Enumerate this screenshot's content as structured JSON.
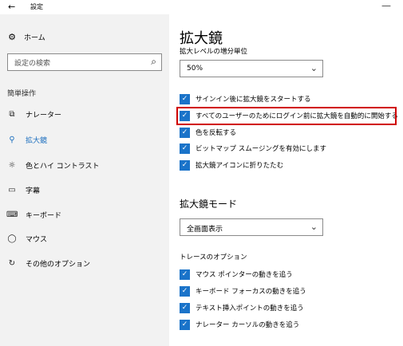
{
  "window": {
    "title": "設定",
    "back_glyph": "←",
    "minimize_glyph": "—"
  },
  "sidebar": {
    "home": {
      "label": "ホーム",
      "icon": "gear-icon",
      "glyph": "⚙"
    },
    "search": {
      "placeholder": "設定の検索",
      "icon": "search-icon",
      "glyph": "⌕"
    },
    "section_heading": "簡単操作",
    "items": [
      {
        "label": "ナレーター",
        "icon": "narrator-icon",
        "glyph": "⧉",
        "active": false
      },
      {
        "label": "拡大鏡",
        "icon": "magnifier-icon",
        "glyph": "⚲",
        "active": true
      },
      {
        "label": "色とハイ コントラスト",
        "icon": "sun-icon",
        "glyph": "☼",
        "active": false
      },
      {
        "label": "字幕",
        "icon": "captions-icon",
        "glyph": "▭",
        "active": false
      },
      {
        "label": "キーボード",
        "icon": "keyboard-icon",
        "glyph": "⌨",
        "active": false
      },
      {
        "label": "マウス",
        "icon": "mouse-icon",
        "glyph": "◯",
        "active": false
      },
      {
        "label": "その他のオプション",
        "icon": "options-icon",
        "glyph": "↻",
        "active": false
      }
    ]
  },
  "main": {
    "title": "拡大鏡",
    "zoom_increment": {
      "label": "拡大レベルの増分単位",
      "value": "50%"
    },
    "checks": [
      {
        "label": "サインイン後に拡大鏡をスタートする",
        "checked": true
      },
      {
        "label": "すべてのユーザーのためにログイン前に拡大鏡を自動的に開始する",
        "checked": true
      },
      {
        "label": "色を反転する",
        "checked": true
      },
      {
        "label": "ビットマップ スムージングを有効にします",
        "checked": true
      },
      {
        "label": "拡大鏡アイコンに折りたたむ",
        "checked": true
      }
    ],
    "mode": {
      "title": "拡大鏡モード",
      "value": "全画面表示"
    },
    "tracking": {
      "label": "トレースのオプション",
      "checks": [
        {
          "label": "マウス ポインターの動きを追う",
          "checked": true
        },
        {
          "label": "キーボード フォーカスの動きを追う",
          "checked": true
        },
        {
          "label": "テキスト挿入ポイントの動きを追う",
          "checked": true
        },
        {
          "label": "ナレーター カーソルの動きを追う",
          "checked": true
        }
      ]
    }
  },
  "glyphs": {
    "check": "✓",
    "chevron": "⌄"
  },
  "colors": {
    "accent": "#1a73c9",
    "active_nav": "#1d6fbf",
    "highlight": "#d00000",
    "sidebar_bg": "#f2f2f2"
  }
}
